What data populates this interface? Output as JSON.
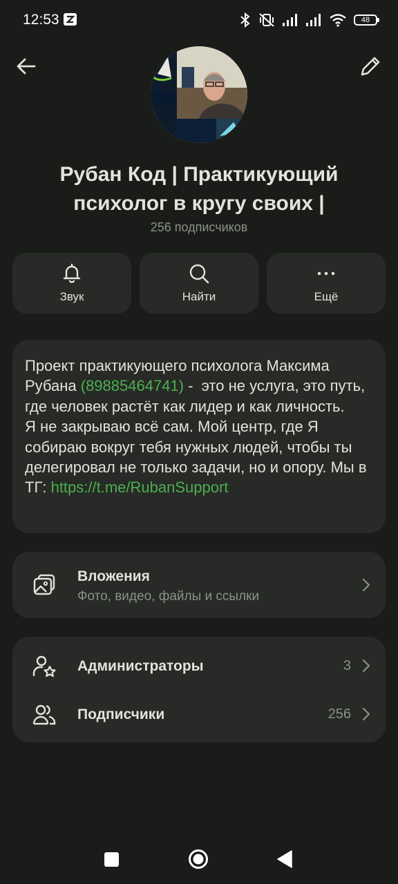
{
  "status_bar": {
    "time": "12:53",
    "battery": "48"
  },
  "channel": {
    "title": "Рубан Код | Практикующий психолог в кругу своих |",
    "subscribers": "256 подписчиков"
  },
  "actions": [
    {
      "label": "Звук",
      "icon": "bell-icon"
    },
    {
      "label": "Найти",
      "icon": "search-icon"
    },
    {
      "label": "Ещё",
      "icon": "more-icon"
    }
  ],
  "description": {
    "part1": "Проект практикующего психолога Максима Рубана ",
    "phone": "(89885464741)",
    "part2": " -  это не услуга, это путь, где человек растёт как лидер и как личность.\nЯ не закрываю всё сам. Мой центр, где Я собираю вокруг тебя нужных людей, чтобы ты делегировал не только задачи, но и опору. Мы в ТГ: ",
    "link": "https://t.me/RubanSupport"
  },
  "attachments": {
    "title": "Вложения",
    "subtitle": "Фото, видео, файлы и ссылки"
  },
  "admins": {
    "title": "Администраторы",
    "count": "3"
  },
  "members": {
    "title": "Подписчики",
    "count": "256"
  },
  "colors": {
    "background": "#1a1c19",
    "card": "#272a26",
    "link": "#4caf50",
    "secondary_text": "#8d918a"
  }
}
